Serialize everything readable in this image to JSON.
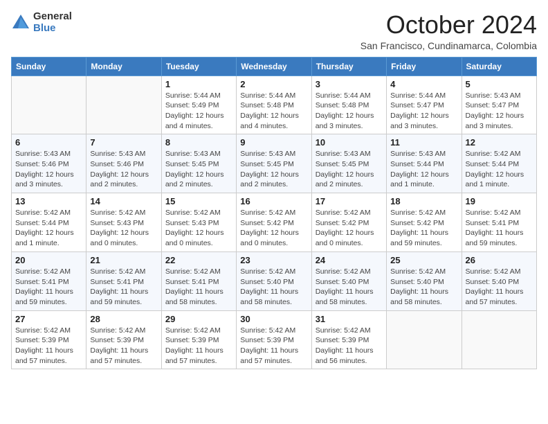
{
  "logo": {
    "general": "General",
    "blue": "Blue"
  },
  "header": {
    "month_year": "October 2024",
    "location": "San Francisco, Cundinamarca, Colombia"
  },
  "weekdays": [
    "Sunday",
    "Monday",
    "Tuesday",
    "Wednesday",
    "Thursday",
    "Friday",
    "Saturday"
  ],
  "weeks": [
    [
      {
        "day": "",
        "info": ""
      },
      {
        "day": "",
        "info": ""
      },
      {
        "day": "1",
        "info": "Sunrise: 5:44 AM\nSunset: 5:49 PM\nDaylight: 12 hours and 4 minutes."
      },
      {
        "day": "2",
        "info": "Sunrise: 5:44 AM\nSunset: 5:48 PM\nDaylight: 12 hours and 4 minutes."
      },
      {
        "day": "3",
        "info": "Sunrise: 5:44 AM\nSunset: 5:48 PM\nDaylight: 12 hours and 3 minutes."
      },
      {
        "day": "4",
        "info": "Sunrise: 5:44 AM\nSunset: 5:47 PM\nDaylight: 12 hours and 3 minutes."
      },
      {
        "day": "5",
        "info": "Sunrise: 5:43 AM\nSunset: 5:47 PM\nDaylight: 12 hours and 3 minutes."
      }
    ],
    [
      {
        "day": "6",
        "info": "Sunrise: 5:43 AM\nSunset: 5:46 PM\nDaylight: 12 hours and 3 minutes."
      },
      {
        "day": "7",
        "info": "Sunrise: 5:43 AM\nSunset: 5:46 PM\nDaylight: 12 hours and 2 minutes."
      },
      {
        "day": "8",
        "info": "Sunrise: 5:43 AM\nSunset: 5:45 PM\nDaylight: 12 hours and 2 minutes."
      },
      {
        "day": "9",
        "info": "Sunrise: 5:43 AM\nSunset: 5:45 PM\nDaylight: 12 hours and 2 minutes."
      },
      {
        "day": "10",
        "info": "Sunrise: 5:43 AM\nSunset: 5:45 PM\nDaylight: 12 hours and 2 minutes."
      },
      {
        "day": "11",
        "info": "Sunrise: 5:43 AM\nSunset: 5:44 PM\nDaylight: 12 hours and 1 minute."
      },
      {
        "day": "12",
        "info": "Sunrise: 5:42 AM\nSunset: 5:44 PM\nDaylight: 12 hours and 1 minute."
      }
    ],
    [
      {
        "day": "13",
        "info": "Sunrise: 5:42 AM\nSunset: 5:44 PM\nDaylight: 12 hours and 1 minute."
      },
      {
        "day": "14",
        "info": "Sunrise: 5:42 AM\nSunset: 5:43 PM\nDaylight: 12 hours and 0 minutes."
      },
      {
        "day": "15",
        "info": "Sunrise: 5:42 AM\nSunset: 5:43 PM\nDaylight: 12 hours and 0 minutes."
      },
      {
        "day": "16",
        "info": "Sunrise: 5:42 AM\nSunset: 5:42 PM\nDaylight: 12 hours and 0 minutes."
      },
      {
        "day": "17",
        "info": "Sunrise: 5:42 AM\nSunset: 5:42 PM\nDaylight: 12 hours and 0 minutes."
      },
      {
        "day": "18",
        "info": "Sunrise: 5:42 AM\nSunset: 5:42 PM\nDaylight: 11 hours and 59 minutes."
      },
      {
        "day": "19",
        "info": "Sunrise: 5:42 AM\nSunset: 5:41 PM\nDaylight: 11 hours and 59 minutes."
      }
    ],
    [
      {
        "day": "20",
        "info": "Sunrise: 5:42 AM\nSunset: 5:41 PM\nDaylight: 11 hours and 59 minutes."
      },
      {
        "day": "21",
        "info": "Sunrise: 5:42 AM\nSunset: 5:41 PM\nDaylight: 11 hours and 59 minutes."
      },
      {
        "day": "22",
        "info": "Sunrise: 5:42 AM\nSunset: 5:41 PM\nDaylight: 11 hours and 58 minutes."
      },
      {
        "day": "23",
        "info": "Sunrise: 5:42 AM\nSunset: 5:40 PM\nDaylight: 11 hours and 58 minutes."
      },
      {
        "day": "24",
        "info": "Sunrise: 5:42 AM\nSunset: 5:40 PM\nDaylight: 11 hours and 58 minutes."
      },
      {
        "day": "25",
        "info": "Sunrise: 5:42 AM\nSunset: 5:40 PM\nDaylight: 11 hours and 58 minutes."
      },
      {
        "day": "26",
        "info": "Sunrise: 5:42 AM\nSunset: 5:40 PM\nDaylight: 11 hours and 57 minutes."
      }
    ],
    [
      {
        "day": "27",
        "info": "Sunrise: 5:42 AM\nSunset: 5:39 PM\nDaylight: 11 hours and 57 minutes."
      },
      {
        "day": "28",
        "info": "Sunrise: 5:42 AM\nSunset: 5:39 PM\nDaylight: 11 hours and 57 minutes."
      },
      {
        "day": "29",
        "info": "Sunrise: 5:42 AM\nSunset: 5:39 PM\nDaylight: 11 hours and 57 minutes."
      },
      {
        "day": "30",
        "info": "Sunrise: 5:42 AM\nSunset: 5:39 PM\nDaylight: 11 hours and 57 minutes."
      },
      {
        "day": "31",
        "info": "Sunrise: 5:42 AM\nSunset: 5:39 PM\nDaylight: 11 hours and 56 minutes."
      },
      {
        "day": "",
        "info": ""
      },
      {
        "day": "",
        "info": ""
      }
    ]
  ]
}
